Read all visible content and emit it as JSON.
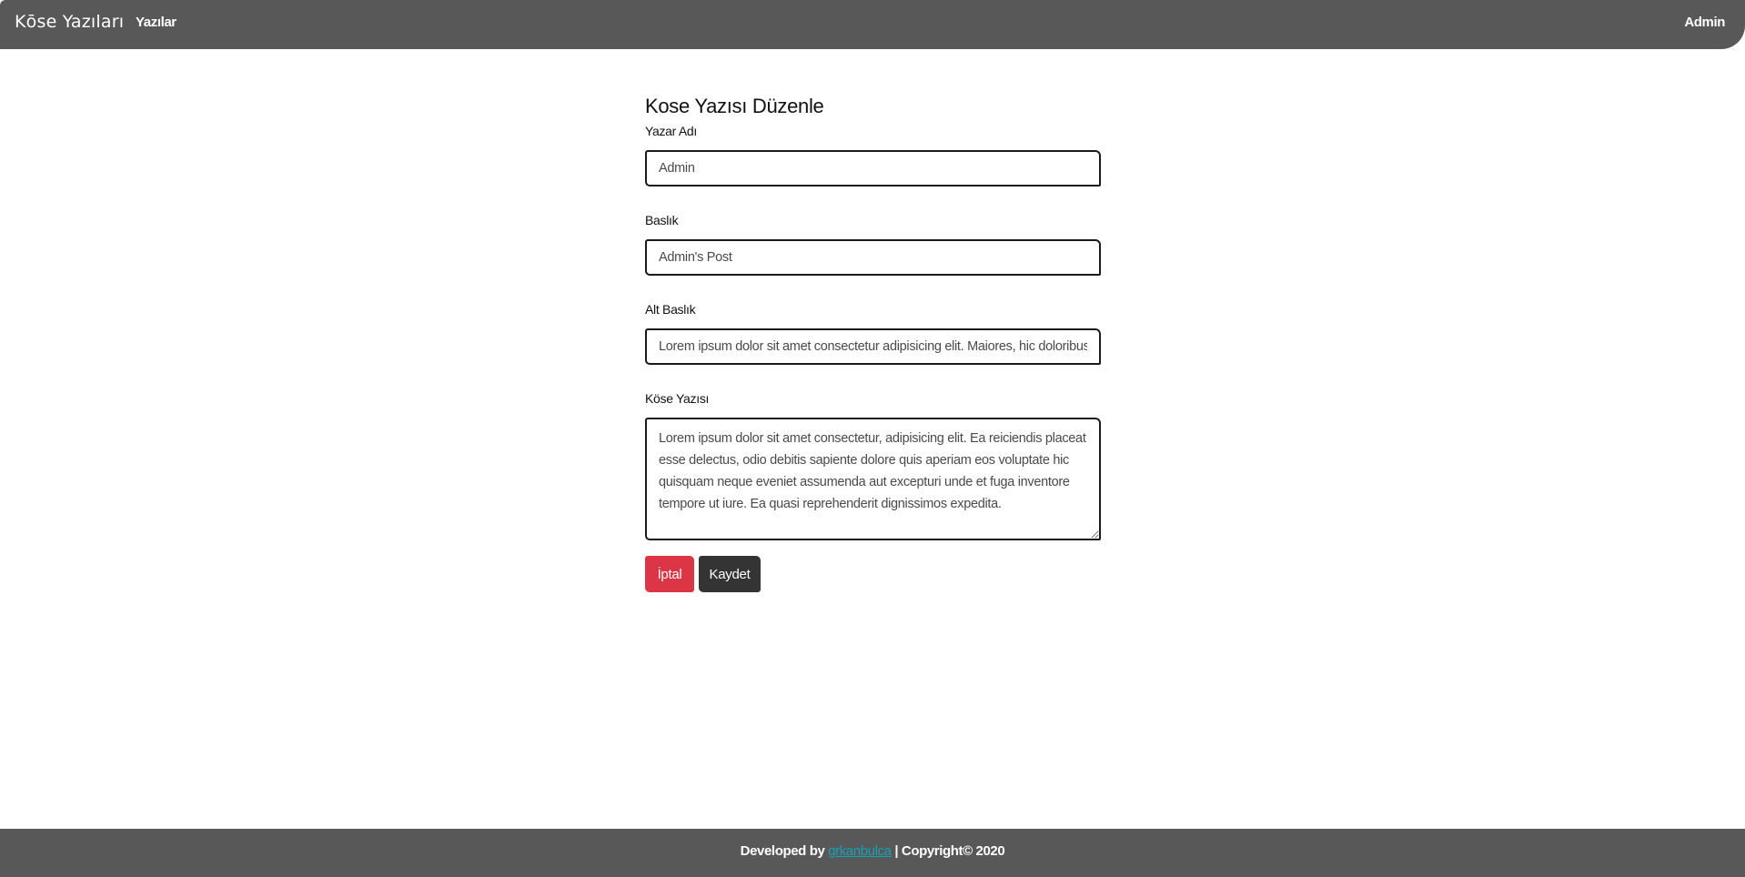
{
  "navbar": {
    "brand": "Kōse Yazıları",
    "nav_link": "Yazılar",
    "user": "Admin"
  },
  "form": {
    "title": "Kose Yazısı Düzenle",
    "author_label": "Yazar Adı",
    "author_value": "Admin",
    "title_label": "Baslık",
    "title_value": "Admin's Post",
    "subtitle_label": "Alt Baslık",
    "subtitle_value": "Lorem ipsum dolor sit amet consectetur adipisicing elit. Maiores, hic doloribus!",
    "body_label": "Köse Yazısı",
    "body_value": "Lorem ipsum dolor sit amet consectetur, adipisicing elit. Ea reiciendis placeat esse delectus, odio debitis sapiente dolore quis aperiam eos voluptate hic quisquam neque eveniet assumenda aut excepturi unde et fuga inventore tempore ut iure. Ea quasi reprehenderit dignissimos expedita.",
    "cancel_label": "İptal",
    "save_label": "Kaydet"
  },
  "footer": {
    "prefix": "Developed by ",
    "link": "grkanbulca",
    "suffix": " | Copyright© 2020"
  },
  "colors": {
    "navbar_bg": "#585858",
    "cancel_button": "#dc3545",
    "save_button": "#343434",
    "footer_link": "#17a2b8"
  }
}
